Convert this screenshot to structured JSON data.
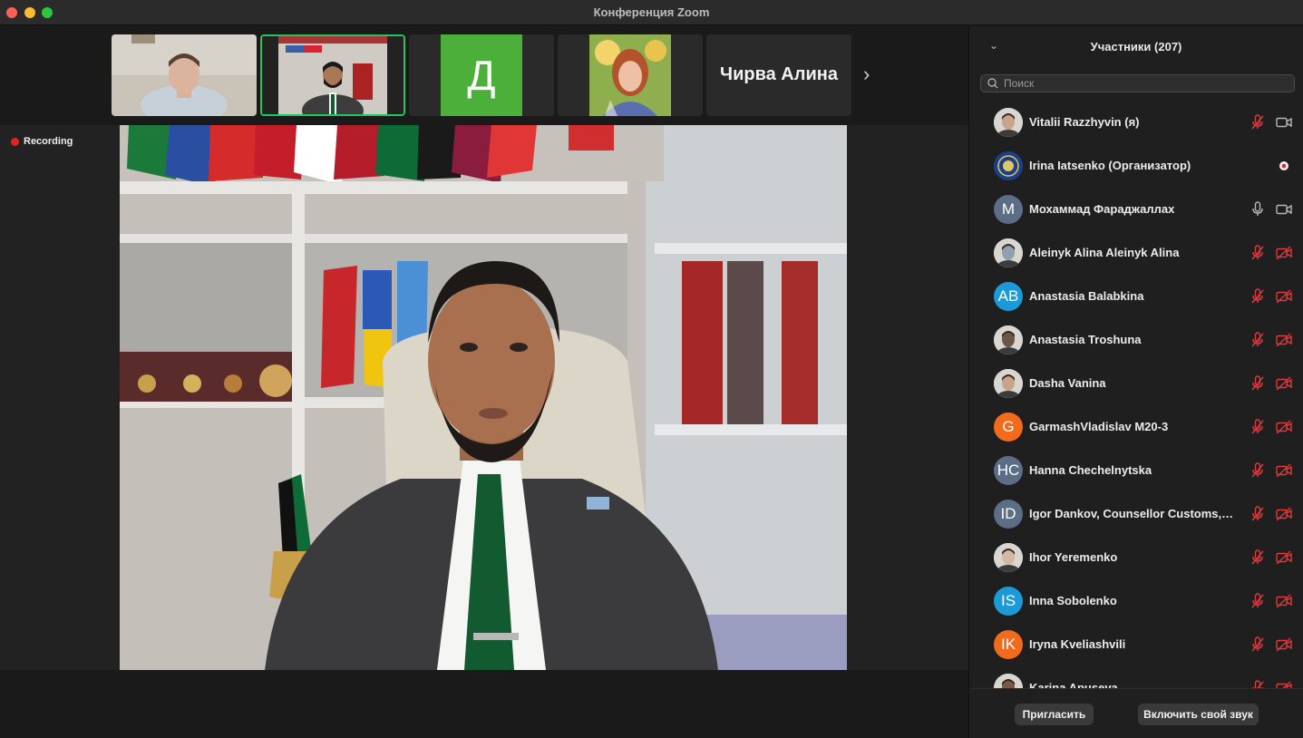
{
  "window": {
    "title": "Конференция Zoom"
  },
  "thumbnails": [
    {
      "kind": "video",
      "label": ""
    },
    {
      "kind": "video",
      "label": ""
    },
    {
      "kind": "initial",
      "initial": "Д",
      "color": "#4caf3a"
    },
    {
      "kind": "video",
      "label": ""
    },
    {
      "kind": "name",
      "name": "Чирва Алина"
    }
  ],
  "recording": {
    "label": "Recording",
    "color": "#e02424"
  },
  "participants_panel": {
    "title": "Участники (207)",
    "search_placeholder": "Поиск",
    "participants": [
      {
        "name": "Vitalii Razzhyvin (я)",
        "avatar": "photo",
        "mic": "muted",
        "camera": "on"
      },
      {
        "name": "Irina Iatsenko (Организатор)",
        "avatar": "emblem",
        "mic": "none",
        "camera": "recording"
      },
      {
        "name": "Мохаммад Фараджаллах",
        "avatar": "M",
        "avatar_color": "#5b6e86",
        "mic": "on",
        "camera": "on"
      },
      {
        "name": "Aleinyk Alina Aleinyk Alina",
        "avatar": "photo",
        "mic": "muted",
        "camera": "off"
      },
      {
        "name": "Anastasia Balabkina",
        "avatar": "AB",
        "avatar_color": "#1a9bd8",
        "mic": "muted",
        "camera": "off"
      },
      {
        "name": "Anastasia Troshuna",
        "avatar": "photo",
        "mic": "muted",
        "camera": "off"
      },
      {
        "name": "Dasha Vanina",
        "avatar": "photo",
        "mic": "muted",
        "camera": "off"
      },
      {
        "name": "GarmashVladislav M20-3",
        "avatar": "G",
        "avatar_color": "#f26b1d",
        "mic": "muted",
        "camera": "off"
      },
      {
        "name": "Hanna Chechelnytska",
        "avatar": "HC",
        "avatar_color": "#5b6e86",
        "mic": "muted",
        "camera": "off"
      },
      {
        "name": "Igor Dankov, Counsellor Customs, Mi...",
        "avatar": "ID",
        "avatar_color": "#5b6e86",
        "mic": "muted",
        "camera": "off"
      },
      {
        "name": "Ihor Yeremenko",
        "avatar": "photo",
        "mic": "muted",
        "camera": "off"
      },
      {
        "name": "Inna Sobolenko",
        "avatar": "IS",
        "avatar_color": "#1a9bd8",
        "mic": "muted",
        "camera": "off"
      },
      {
        "name": "Iryna Kveliashvili",
        "avatar": "IK",
        "avatar_color": "#f26b1d",
        "mic": "muted",
        "camera": "off"
      },
      {
        "name": "Karina Apuseva",
        "avatar": "photo",
        "mic": "muted",
        "camera": "off"
      }
    ]
  },
  "footer": {
    "invite_label": "Пригласить",
    "unmute_label": "Включить свой звук"
  }
}
